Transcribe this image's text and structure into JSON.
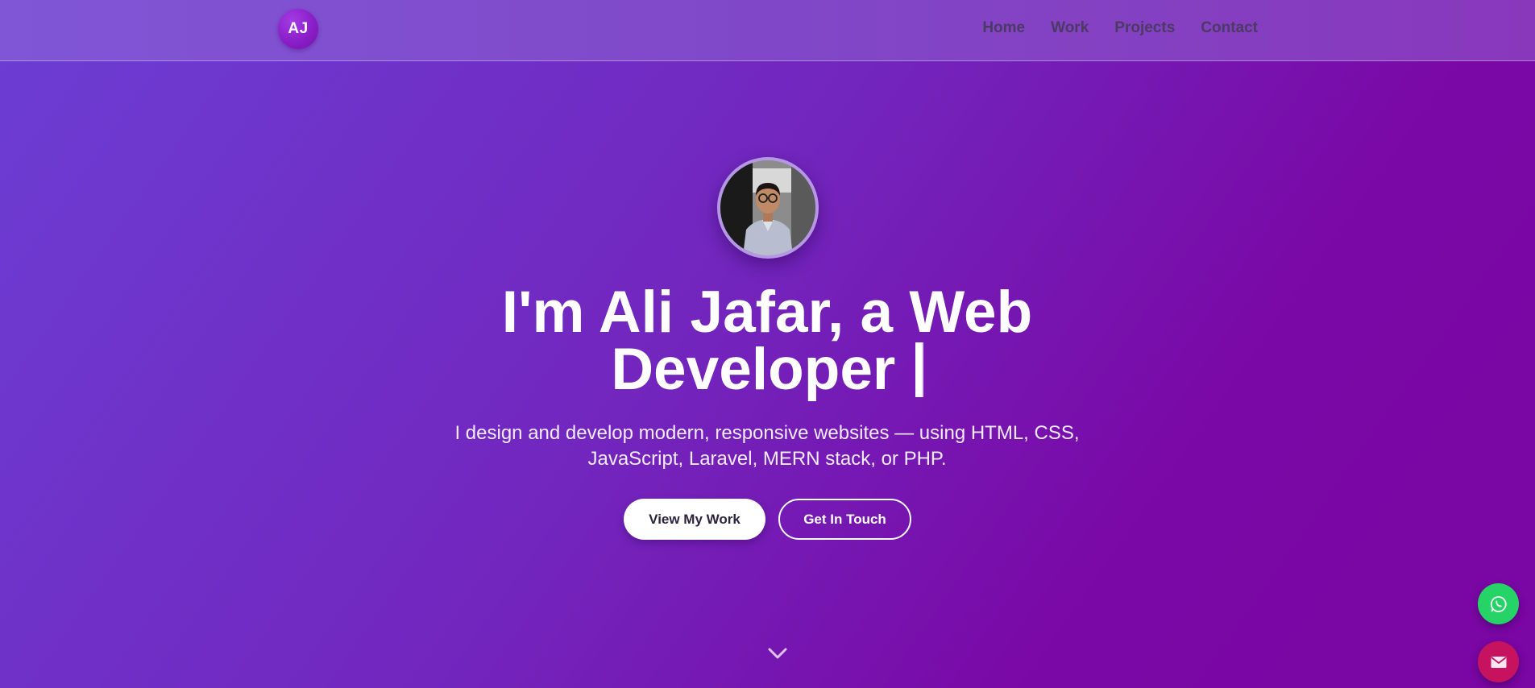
{
  "navbar": {
    "logo_text": "AJ",
    "links": [
      {
        "label": "Home"
      },
      {
        "label": "Work"
      },
      {
        "label": "Projects"
      },
      {
        "label": "Contact"
      }
    ]
  },
  "hero": {
    "avatar_icon": "profile-photo",
    "headline_line1": "I'm Ali Jafar, a Web",
    "headline_line2": "Developer",
    "tagline_line1": "I design and develop modern, responsive websites — using HTML, CSS,",
    "tagline_line2": "JavaScript, Laravel, MERN stack, or PHP.",
    "primary_button": "View My Work",
    "secondary_button": "Get In Touch",
    "scroll_icon": "chevron-down-icon"
  },
  "floating_actions": [
    {
      "icon": "whatsapp-icon",
      "color": "#25d366"
    },
    {
      "icon": "mail-icon",
      "color": "#c7125f"
    }
  ],
  "colors": {
    "background_start": "#6c3ed4",
    "background_end": "#7a06a3",
    "nav_link": "#4a3a64",
    "logo_badge": "#8a1ec8"
  }
}
